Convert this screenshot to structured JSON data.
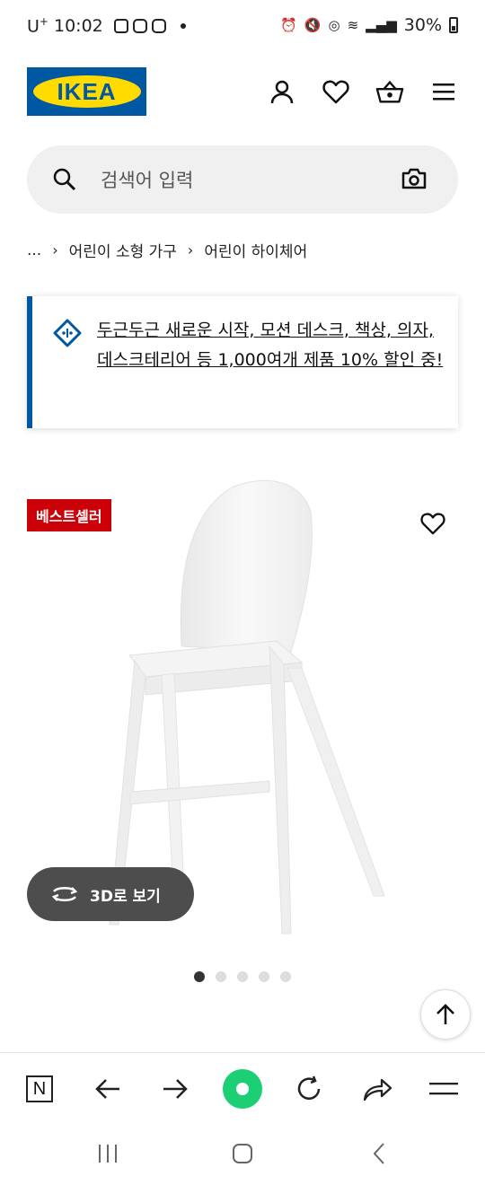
{
  "status_bar": {
    "carrier": "U",
    "carrier_sup": "+",
    "time": "10:02",
    "battery": "30%"
  },
  "header": {
    "logo_text": "IKEA"
  },
  "search": {
    "placeholder": "검색어 입력"
  },
  "breadcrumb": {
    "ellipsis": "...",
    "items": [
      "어린이 소형 가구",
      "어린이 하이체어"
    ],
    "separator": "›"
  },
  "promo": {
    "text": "두근두근 새로운 시작, 모션 데스크, 책상, 의자, 데스크테리어 등 1,000여개 제품 10% 할인 중!",
    "accent_color": "#0058a3"
  },
  "product": {
    "badge": "베스트셀러",
    "badge_color": "#cc0008",
    "view3d_label": "3D로 보기",
    "image_count": 5,
    "active_image_index": 0
  },
  "colors": {
    "ikea_blue": "#0058a3",
    "ikea_yellow": "#ffdb00",
    "naver_green": "#1ccf74"
  }
}
